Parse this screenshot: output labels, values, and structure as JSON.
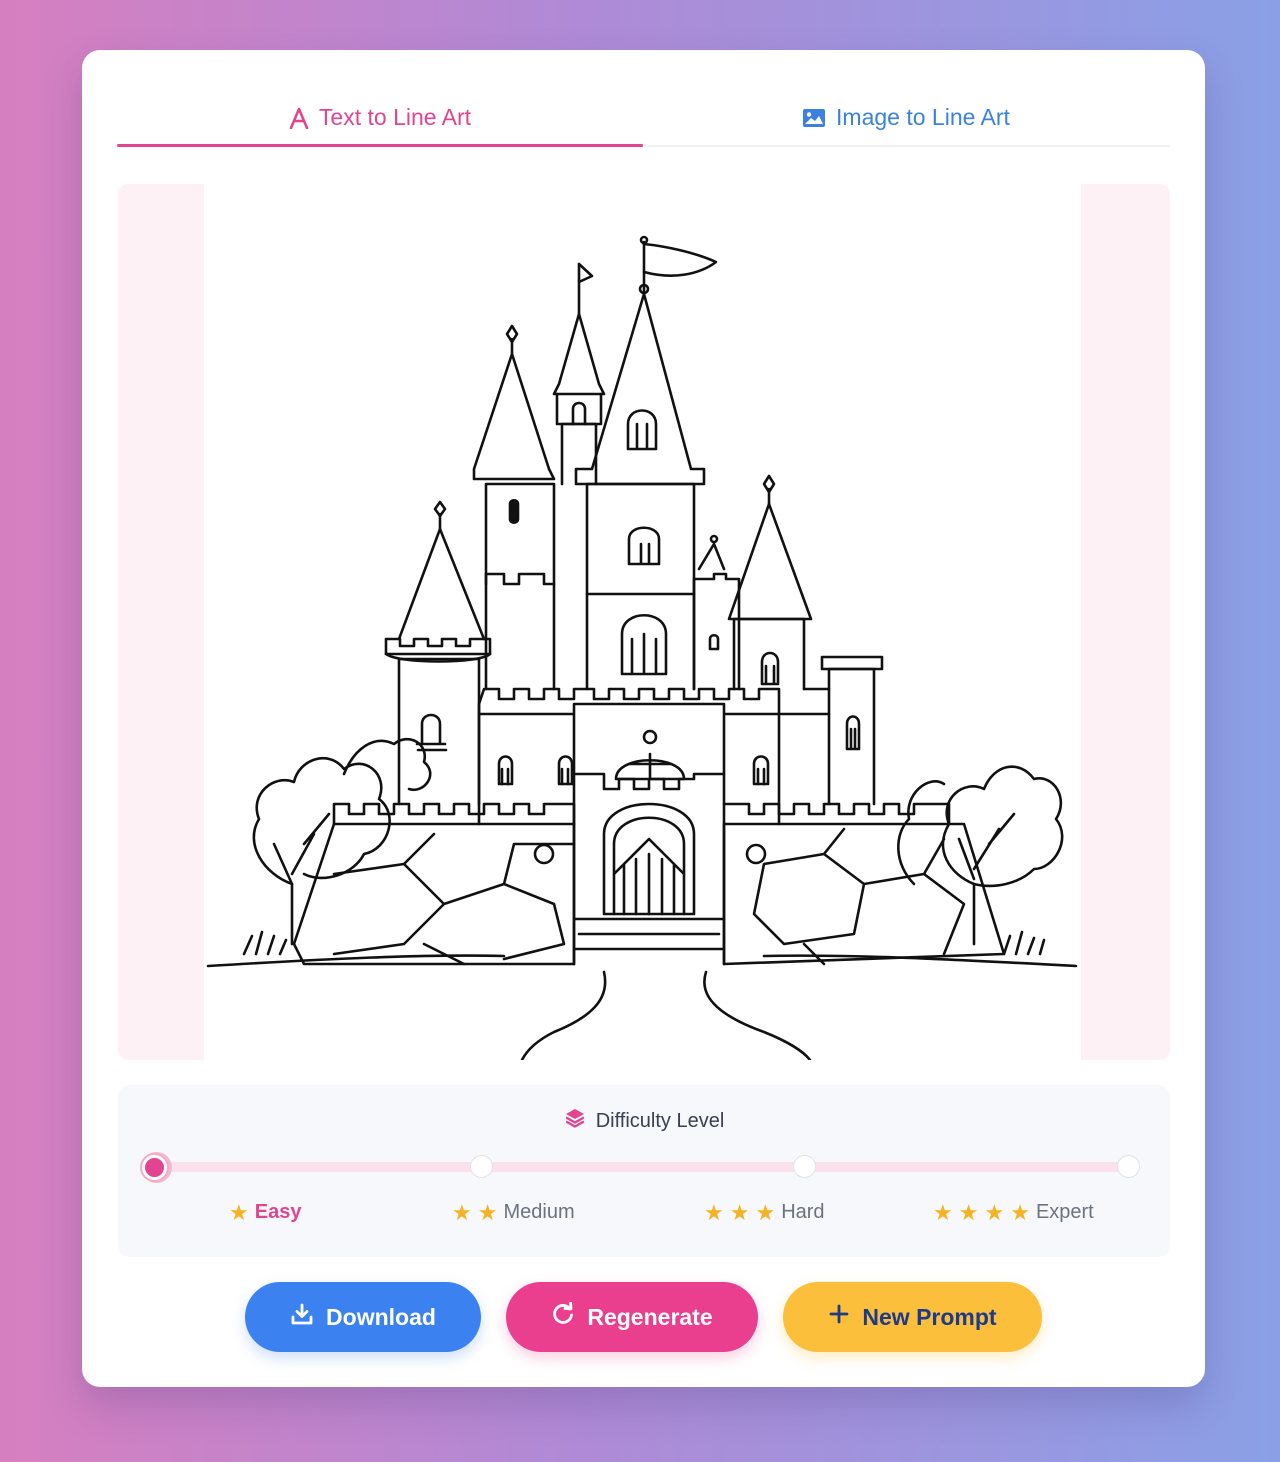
{
  "tabs": [
    {
      "label": "Text to Line Art",
      "icon": "text-a-icon",
      "active": true
    },
    {
      "label": "Image to Line Art",
      "icon": "image-icon",
      "active": false
    }
  ],
  "image": {
    "subject": "castle line art coloring page",
    "alt": "Castle line art"
  },
  "difficulty": {
    "title": "Difficulty Level",
    "icon": "layers-icon",
    "selected": 0,
    "levels": [
      {
        "label": "Easy",
        "stars": 1
      },
      {
        "label": "Medium",
        "stars": 2
      },
      {
        "label": "Hard",
        "stars": 3
      },
      {
        "label": "Expert",
        "stars": 4
      }
    ]
  },
  "actions": {
    "download": {
      "label": "Download",
      "icon": "download-icon"
    },
    "regenerate": {
      "label": "Regenerate",
      "icon": "refresh-icon"
    },
    "new_prompt": {
      "label": "New Prompt",
      "icon": "plus-icon"
    }
  },
  "colors": {
    "accent_pink": "#e2458f",
    "accent_blue": "#3b82f0",
    "accent_yellow": "#fbbf3b",
    "star": "#f5b324"
  }
}
